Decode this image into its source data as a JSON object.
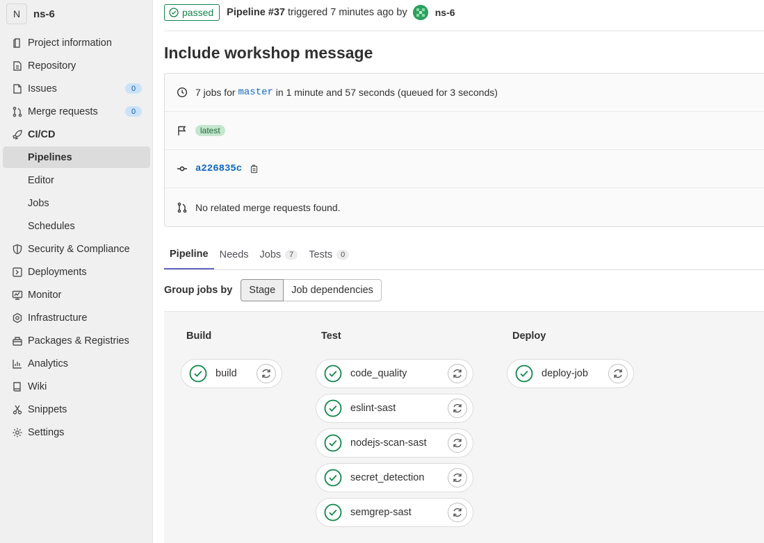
{
  "sidebar": {
    "avatar_letter": "N",
    "project_name": "ns-6",
    "items": [
      {
        "label": "Project information",
        "icon": "project-icon"
      },
      {
        "label": "Repository",
        "icon": "doc-icon"
      },
      {
        "label": "Issues",
        "icon": "issues-icon",
        "badge": "0"
      },
      {
        "label": "Merge requests",
        "icon": "merge-request-icon",
        "badge": "0"
      },
      {
        "label": "CI/CD",
        "icon": "rocket-icon"
      },
      {
        "label": "Pipelines"
      },
      {
        "label": "Editor"
      },
      {
        "label": "Jobs"
      },
      {
        "label": "Schedules"
      },
      {
        "label": "Security & Compliance",
        "icon": "shield-icon"
      },
      {
        "label": "Deployments",
        "icon": "deployments-icon"
      },
      {
        "label": "Monitor",
        "icon": "monitor-icon"
      },
      {
        "label": "Infrastructure",
        "icon": "cloud-gear-icon"
      },
      {
        "label": "Packages & Registries",
        "icon": "package-icon"
      },
      {
        "label": "Analytics",
        "icon": "chart-icon"
      },
      {
        "label": "Wiki",
        "icon": "book-icon"
      },
      {
        "label": "Snippets",
        "icon": "scissors-icon"
      },
      {
        "label": "Settings",
        "icon": "gear-icon"
      }
    ]
  },
  "header": {
    "status": "passed",
    "pipeline": "Pipeline #37",
    "triggered_text": "triggered 7 minutes ago by",
    "user": "ns-6"
  },
  "title": "Include workshop message",
  "info": {
    "jobs_prefix": "7 jobs for",
    "branch": "master",
    "jobs_suffix": "in 1 minute and 57 seconds (queued for 3 seconds)",
    "tag": "latest",
    "commit": "a226835c",
    "merge_requests": "No related merge requests found."
  },
  "tabs": [
    {
      "label": "Pipeline"
    },
    {
      "label": "Needs"
    },
    {
      "label": "Jobs",
      "count": "7"
    },
    {
      "label": "Tests",
      "count": "0"
    }
  ],
  "group": {
    "label": "Group jobs by",
    "options": [
      "Stage",
      "Job dependencies"
    ]
  },
  "stages": [
    {
      "name": "Build",
      "jobs": [
        "build"
      ]
    },
    {
      "name": "Test",
      "jobs": [
        "code_quality",
        "eslint-sast",
        "nodejs-scan-sast",
        "secret_detection",
        "semgrep-sast"
      ]
    },
    {
      "name": "Deploy",
      "jobs": [
        "deploy-job"
      ]
    }
  ],
  "colors": {
    "success": "#108548",
    "link": "#1068bf",
    "tab_active": "#6666c4"
  }
}
